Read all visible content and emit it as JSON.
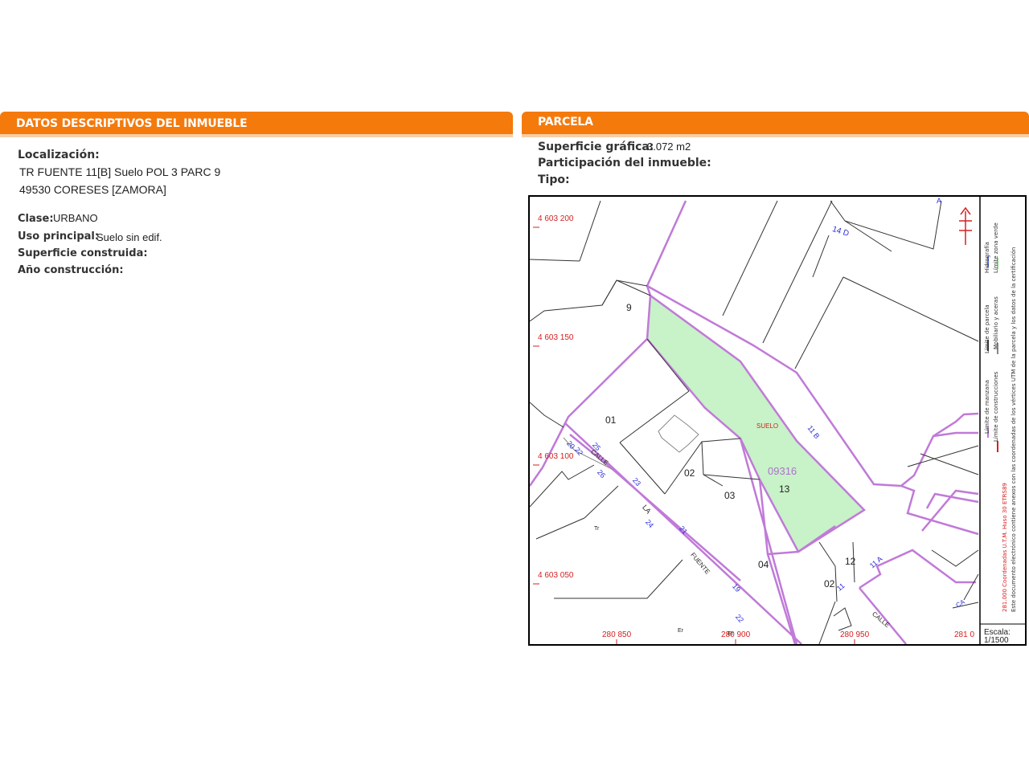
{
  "left_panel": {
    "title": "DATOS DESCRIPTIVOS DEL INMUEBLE",
    "localizacion_label": "Localización:",
    "address_line1": "TR FUENTE 11[B] Suelo POL 3 PARC 9",
    "address_line2": "49530 CORESES [ZAMORA]",
    "clase_label": "Clase:",
    "clase_value": "URBANO",
    "uso_label": "Uso principal:",
    "uso_value": "Suelo sin edif.",
    "superficie_construida_label": "Superficie construida:",
    "anio_label": "Año construcción:"
  },
  "right_panel": {
    "title": "PARCELA",
    "superficie_grafica_label": "Superficie gráfica:",
    "superficie_grafica_value": "3.072 m2",
    "participacion_label": "Participación del inmueble:",
    "tipo_label": "Tipo:"
  },
  "map": {
    "y_coords": [
      "4 603 200",
      "4 603 150",
      "4 603 100",
      "4 603 050"
    ],
    "x_coords": [
      "280 850",
      "280 900",
      "280 950",
      "281 0"
    ],
    "parcel_id": "09316",
    "parcel_number": "13",
    "suelo_label": "SUELO",
    "parcel_labels": [
      "9",
      "01",
      "02",
      "03",
      "04",
      "12",
      "02"
    ],
    "street_labels": [
      "14 D",
      "11 B",
      "11 A",
      "CALLE",
      "LA",
      "FUENTE",
      "CALLE",
      "CA"
    ],
    "house_numbers": [
      "25",
      "26",
      "22",
      "23",
      "24",
      "21",
      "19",
      "22",
      "20",
      "11",
      "Tr",
      "Er",
      "Er",
      "A"
    ],
    "scale_label": "Escala:",
    "scale_value": "1/1500",
    "legend": {
      "manzana": "Límite de manzana",
      "parcela": "Límite de parcela",
      "hidrografia": "Hidrografía",
      "construcciones": "Límite de construcciones",
      "mobiliario": "Mobiliario y aceras",
      "zona_verde": "Límite zona verde",
      "coords_note": "281.000 Coordenadas U.T.M. Huso 30 ETRS89",
      "doc_note": "Este documento electrónico contiene anexos con las coordenadas de los vértices UTM de la parcela y los datos de la certificación"
    },
    "colors": {
      "parcel_fill": "#c8f2c8",
      "block_line": "#c07ad8",
      "coord_red": "#d62020",
      "label_blue": "#2a2adb",
      "header_orange": "#f47a0c"
    }
  }
}
